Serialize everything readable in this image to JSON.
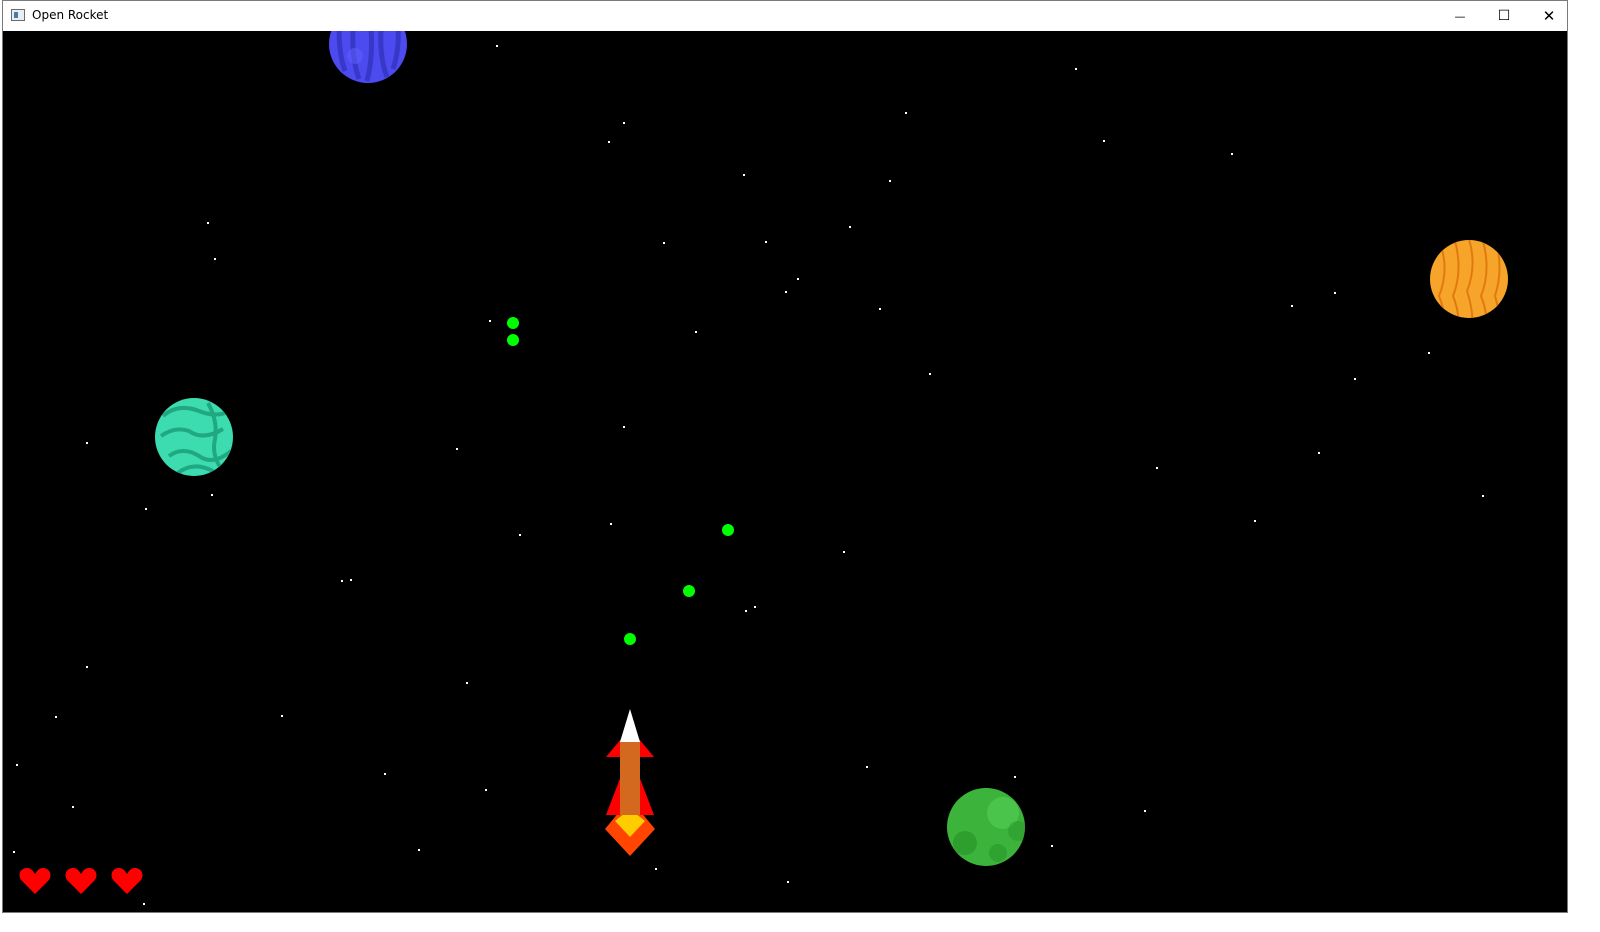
{
  "window": {
    "title": "Open Rocket",
    "controls": {
      "minimize": "—",
      "maximize": "☐",
      "close": "✕"
    }
  },
  "game": {
    "background_color": "#000000",
    "lives": 3,
    "heart_color": "#ff0000",
    "player": {
      "name": "rocket",
      "colors": {
        "nose": "#ffffff",
        "body": "#d2691e",
        "fins": "#ff0000",
        "flame_outer": "#ff4500",
        "flame_inner": "#ffcc00"
      }
    },
    "projectile_color": "#00ff00",
    "planets": [
      {
        "name": "planet-blue",
        "color": "#4b4bf0"
      },
      {
        "name": "planet-teal",
        "color": "#3ddbb0"
      },
      {
        "name": "planet-orange",
        "color": "#f7a52a"
      },
      {
        "name": "planet-green",
        "color": "#3cb43c"
      }
    ]
  }
}
